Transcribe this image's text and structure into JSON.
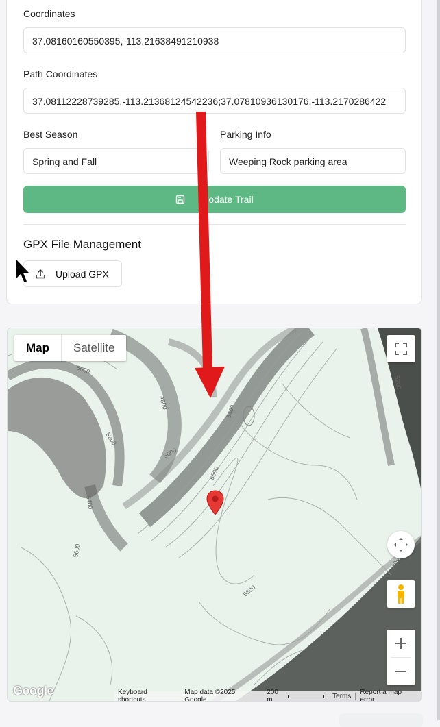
{
  "form": {
    "coordinates_label": "Coordinates",
    "coordinates_value": "37.08160160550395,-113.21638491210938",
    "path_label": "Path Coordinates",
    "path_value": "37.08112228739285,-113.21368124542236;37.07810936130176,-113.2170286422",
    "season_label": "Best Season",
    "season_value": "Spring and Fall",
    "parking_label": "Parking Info",
    "parking_value": "Weeping Rock parking area",
    "update_label": "odate Trail"
  },
  "gpx": {
    "title": "GPX File Management",
    "upload_label": "Upload GPX"
  },
  "map": {
    "type_map": "Map",
    "type_satellite": "Satellite",
    "logo": "Google",
    "footer": {
      "shortcuts": "Keyboard shortcuts",
      "data": "Map data ©2025 Google",
      "scale": "200 m",
      "terms": "Terms",
      "report": "Report a map error"
    },
    "contours": [
      "5000",
      "4800",
      "5200",
      "5000",
      "5400",
      "5400",
      "5600",
      "5600",
      "5600",
      "5200",
      "5200"
    ]
  },
  "colors": {
    "accent_green": "#5eb883",
    "arrow_red": "#e0191a",
    "marker_red": "#e53935"
  },
  "icons": [
    "save-icon",
    "upload-icon",
    "fullscreen-icon",
    "camera-control-icon",
    "pegman-icon",
    "zoom-in-icon",
    "zoom-out-icon",
    "cursor-icon",
    "map-marker-icon"
  ]
}
